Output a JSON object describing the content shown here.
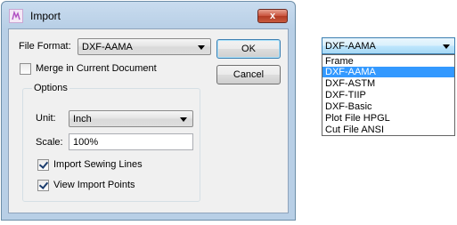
{
  "dialog": {
    "title": "Import",
    "close_glyph": "x",
    "icon": "app-logo-icon"
  },
  "form": {
    "file_format_label": "File Format:",
    "file_format_value": "DXF-AAMA",
    "ok_label": "OK",
    "cancel_label": "Cancel",
    "merge_label": "Merge in Current Document",
    "merge_checked": false
  },
  "options": {
    "group_title": "Options",
    "unit_label": "Unit:",
    "unit_value": "Inch",
    "scale_label": "Scale:",
    "scale_value": "100%",
    "sewing_label": "Import Sewing Lines",
    "sewing_checked": true,
    "points_label": "View Import Points",
    "points_checked": true
  },
  "dropdown": {
    "selected": "DXF-AAMA",
    "items": [
      "Frame",
      "DXF-AAMA",
      "DXF-ASTM",
      "DXF-TIIP",
      "DXF-Basic",
      "Plot File HPGL",
      "Cut File ANSI"
    ],
    "highlighted_index": 1
  },
  "colors": {
    "title_bar": "#b8cfe6",
    "close_button": "#c9523c",
    "selection": "#3399ff"
  }
}
